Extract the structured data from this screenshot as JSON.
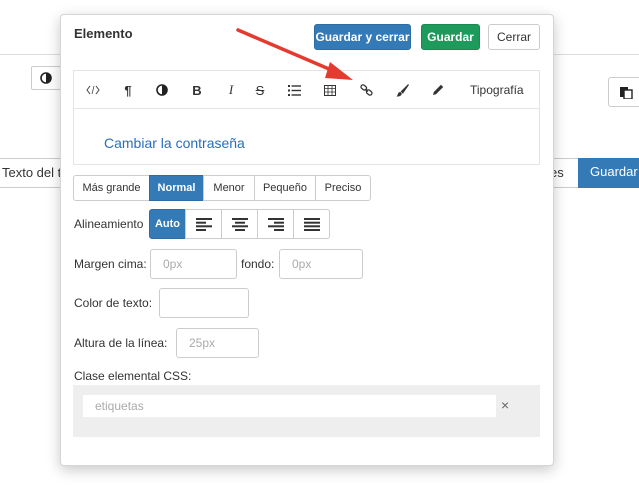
{
  "background": {
    "text_label": "Texto del ti",
    "es_label": "es",
    "guardar_button": "Guardar"
  },
  "modal": {
    "title": "Elemento",
    "buttons": {
      "save_close": "Guardar y cerrar",
      "save": "Guardar",
      "close": "Cerrar"
    },
    "toolbar": {
      "typography": "Tipografía",
      "icons": [
        "code-icon",
        "paragraph-icon",
        "contrast-icon",
        "bold-icon",
        "italic-icon",
        "strikethrough-icon",
        "list-icon",
        "table-icon",
        "link-icon",
        "brush-icon",
        "pencil-icon"
      ]
    },
    "editor_content": "Cambiar la contraseña",
    "size_options": [
      "Más grande",
      "Normal",
      "Menor",
      "Pequeño",
      "Preciso"
    ],
    "size_selected": "Normal",
    "alignment": {
      "label": "Alineamiento",
      "options": [
        "Auto",
        "left-align-icon",
        "center-align-icon",
        "right-align-icon",
        "justify-align-icon"
      ],
      "selected": "Auto"
    },
    "margin": {
      "top_label": "Margen cima:",
      "top_placeholder": "0px",
      "bottom_label": "fondo:",
      "bottom_placeholder": "0px"
    },
    "text_color": {
      "label": "Color de texto:",
      "value": ""
    },
    "line_height": {
      "label": "Altura de la línea:",
      "placeholder": "25px"
    },
    "css_class": {
      "label": "Clase elemental CSS:",
      "placeholder": "etiquetas",
      "clear": "×"
    }
  },
  "colors": {
    "primary": "#337ab7",
    "success": "#1e9a5c",
    "link": "#2a6ebb",
    "arrow": "#e53a2f"
  }
}
